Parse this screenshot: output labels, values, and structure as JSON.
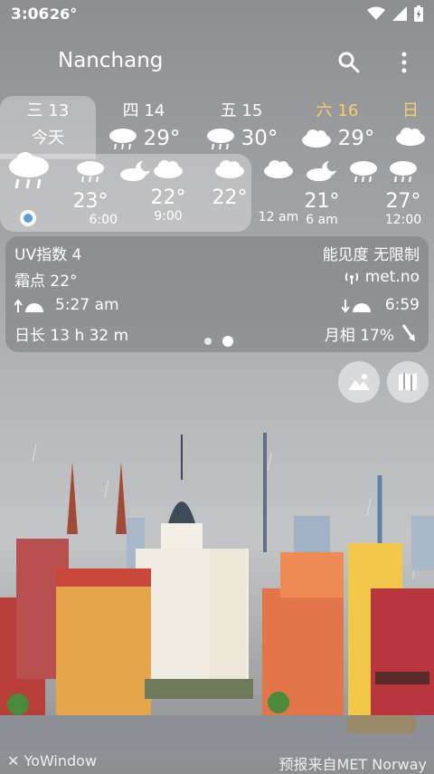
{
  "status_bar": {
    "time": "3:06",
    "temp": "26°",
    "icons": [
      "wifi-icon",
      "signal-icon",
      "battery-icon"
    ]
  },
  "header": {
    "city": "Nanchang"
  },
  "days": [
    {
      "label": "三 13",
      "sub": "今天",
      "temp": "",
      "color": "#ffffff"
    },
    {
      "label": "四 14",
      "sub": "",
      "temp": "29°",
      "color": "#ffffff"
    },
    {
      "label": "五 15",
      "sub": "",
      "temp": "30°",
      "color": "#ffffff"
    },
    {
      "label": "六 16",
      "sub": "",
      "temp": "29°",
      "color": "#f7d06b"
    },
    {
      "label": "日",
      "sub": "",
      "temp": "",
      "color": "#f7d06b"
    }
  ],
  "hourly": [
    {
      "temp": "23°",
      "time": "6:00"
    },
    {
      "temp": "22°",
      "time": "9:00"
    },
    {
      "temp": "22°",
      "time": ""
    },
    {
      "temp": "",
      "time": "12 am"
    },
    {
      "temp": "21°",
      "time": "6 am"
    },
    {
      "temp": "27°",
      "time": "12:00"
    }
  ],
  "info": {
    "uv": "UV指数 4",
    "visibility": "能见度 无限制",
    "dewpoint": "霜点 22°",
    "source_link": "met.no",
    "sunrise": "5:27 am",
    "sunset": "6:59",
    "daylength": "日长 13 h 32 m",
    "moon": "月相 17%"
  },
  "footer": {
    "brand": "YoWindow",
    "provider": "预报来自MET Norway"
  }
}
